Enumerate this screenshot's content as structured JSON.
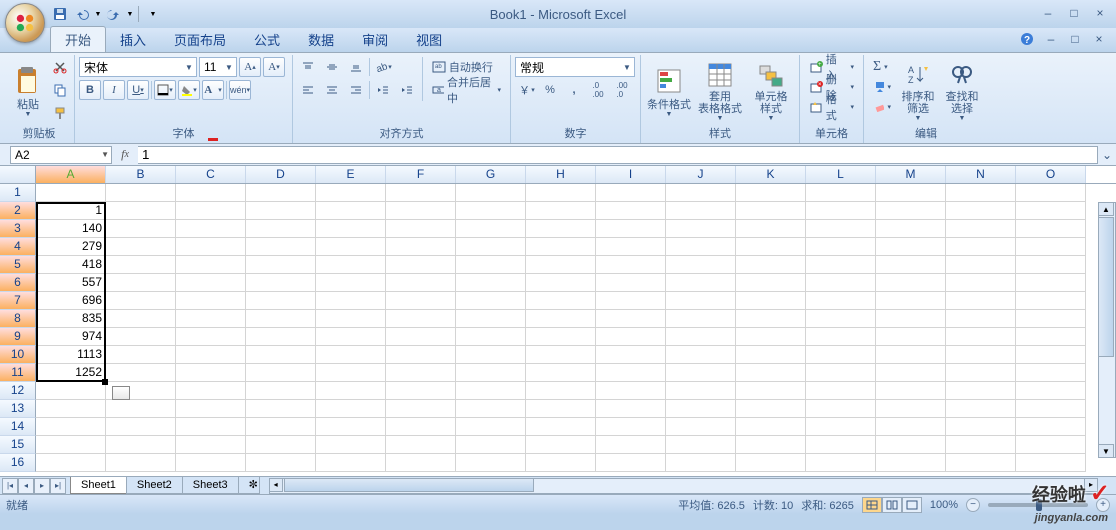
{
  "title": "Book1 - Microsoft Excel",
  "tabs": [
    "开始",
    "插入",
    "页面布局",
    "公式",
    "数据",
    "审阅",
    "视图"
  ],
  "groups": {
    "clipboard": "剪贴板",
    "font": "字体",
    "alignment": "对齐方式",
    "number": "数字",
    "styles": "样式",
    "cells": "单元格",
    "editing": "编辑"
  },
  "paste": "粘贴",
  "font": {
    "name": "宋体",
    "size": "11"
  },
  "bold": "B",
  "italic": "I",
  "underline": "U",
  "wrap_text": "自动换行",
  "merge_center": "合并后居中",
  "number_format": "常规",
  "styles": {
    "conditional": "条件格式",
    "table": "套用\n表格格式",
    "cell": "单元格\n样式"
  },
  "cells": {
    "insert": "插入",
    "delete": "删除",
    "format": "格式"
  },
  "editing": {
    "sort": "排序和\n筛选",
    "find": "查找和\n选择"
  },
  "name_box": "A2",
  "formula": "1",
  "columns": [
    "A",
    "B",
    "C",
    "D",
    "E",
    "F",
    "G",
    "H",
    "I",
    "J",
    "K",
    "L",
    "M",
    "N",
    "O"
  ],
  "chart_data": {
    "type": "table",
    "categories": [
      "A"
    ],
    "rows": [
      1,
      140,
      279,
      418,
      557,
      696,
      835,
      974,
      1113,
      1252
    ]
  },
  "sheets": [
    "Sheet1",
    "Sheet2",
    "Sheet3"
  ],
  "status": {
    "ready": "就绪",
    "avg": "平均值: 626.5",
    "count": "计数: 10",
    "sum": "求和: 6265",
    "zoom": "100%"
  },
  "watermark": "经验啦",
  "watermark_sub": "jingyanla.com"
}
